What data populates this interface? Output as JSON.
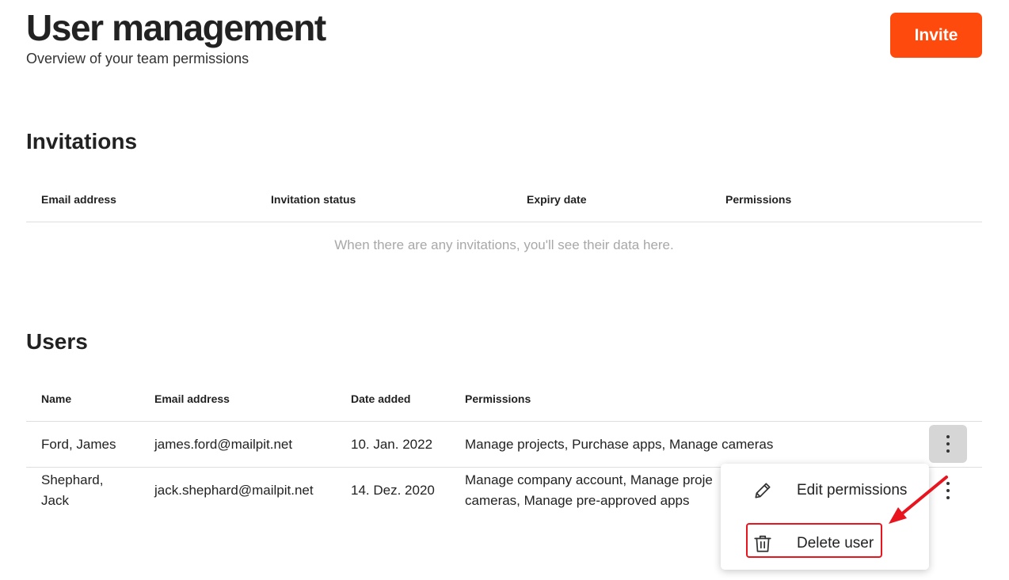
{
  "header": {
    "title": "User management",
    "subtitle": "Overview of your team permissions",
    "invite_label": "Invite"
  },
  "invitations": {
    "title": "Invitations",
    "columns": [
      "Email address",
      "Invitation status",
      "Expiry date",
      "Permissions"
    ],
    "empty_message": "When there are any invitations, you'll see their data here."
  },
  "users": {
    "title": "Users",
    "columns": [
      "Name",
      "Email address",
      "Date added",
      "Permissions"
    ],
    "rows": [
      {
        "name": "Ford, James",
        "email": "james.ford@mailpit.net",
        "date_added": "10. Jan. 2022",
        "permissions": "Manage projects, Purchase apps, Manage cameras"
      },
      {
        "name_line1": "Shephard,",
        "name_line2": "Jack",
        "email": "jack.shephard@mailpit.net",
        "date_added": "14. Dez. 2020",
        "permissions_line1": "Manage company account, Manage proje",
        "permissions_line2": "cameras, Manage pre-approved apps"
      }
    ]
  },
  "context_menu": {
    "items": [
      {
        "label": "Edit permissions",
        "icon": "pencil-icon"
      },
      {
        "label": "Delete user",
        "icon": "trash-icon"
      }
    ]
  },
  "colors": {
    "accent": "#ff4a0d",
    "annotation": "#e8141e"
  }
}
